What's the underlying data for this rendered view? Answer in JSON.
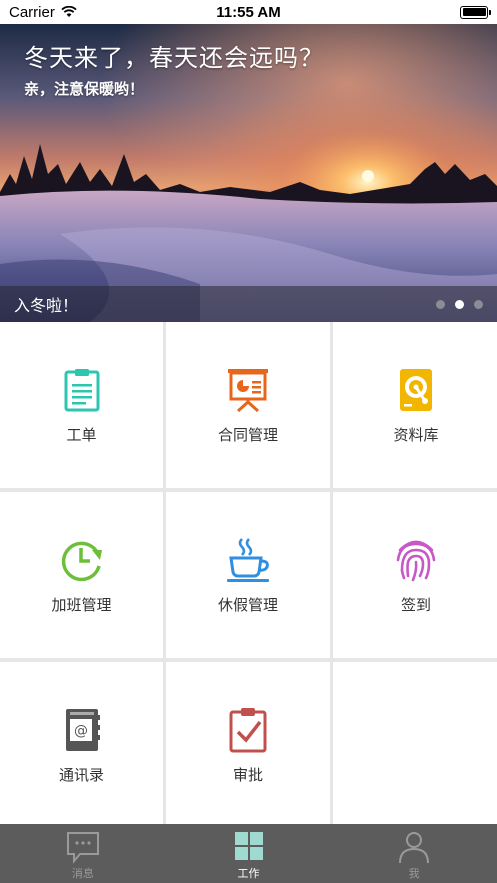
{
  "status_bar": {
    "carrier": "Carrier",
    "time": "11:55 AM"
  },
  "banner": {
    "title": "冬天来了，春天还会远吗？",
    "subtitle": "亲，注意保暖哟！",
    "caption": "入冬啦！",
    "page_count": 3,
    "active_page": 1
  },
  "grid": {
    "items": [
      {
        "label": "工单",
        "icon": "clipboard-icon",
        "color": "#2cc5b0"
      },
      {
        "label": "合同管理",
        "icon": "presentation-icon",
        "color": "#e8651c"
      },
      {
        "label": "资料库",
        "icon": "hard-disk-icon",
        "color": "#f2b600"
      },
      {
        "label": "加班管理",
        "icon": "clock-refresh-icon",
        "color": "#6dbf3a"
      },
      {
        "label": "休假管理",
        "icon": "coffee-cup-icon",
        "color": "#2f8fe0"
      },
      {
        "label": "签到",
        "icon": "fingerprint-icon",
        "color": "#c858c8"
      },
      {
        "label": "通讯录",
        "icon": "address-book-icon",
        "color": "#555555"
      },
      {
        "label": "审批",
        "icon": "approval-clipboard-icon",
        "color": "#c0504d"
      },
      {
        "label": "",
        "icon": "",
        "color": ""
      }
    ]
  },
  "tabbar": {
    "items": [
      {
        "label": "消息",
        "icon": "chat-bubble-icon",
        "active": false
      },
      {
        "label": "工作",
        "icon": "grid-icon",
        "active": true
      },
      {
        "label": "我",
        "icon": "person-icon",
        "active": false
      }
    ],
    "active_icon_color": "#9fd9d0",
    "inactive_color": "#9a9a9a"
  }
}
